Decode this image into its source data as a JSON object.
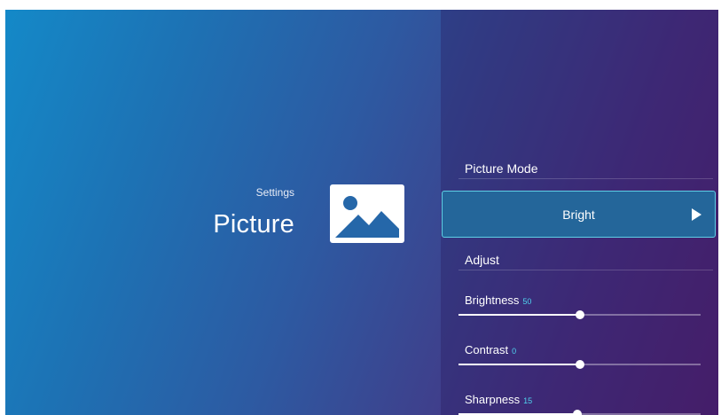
{
  "header": {
    "breadcrumb": "Settings",
    "title": "Picture",
    "icon": "picture-icon"
  },
  "menu": {
    "picture_mode": {
      "label": "Picture Mode",
      "value": "Bright",
      "arrow_icon": "play-right-icon"
    },
    "adjust": {
      "label": "Adjust"
    },
    "sliders": [
      {
        "label": "Brightness",
        "value": "50",
        "fraction": 0.5
      },
      {
        "label": "Contrast",
        "value": "0",
        "fraction": 0.5
      },
      {
        "label": "Sharpness",
        "value": "15",
        "fraction": 0.49
      }
    ]
  },
  "colors": {
    "accent": "#4fd3ee",
    "selector_fill": "#24669a",
    "selector_border": "#5fd0e6",
    "gradient_start": "#1489c8",
    "gradient_end": "#55206f"
  }
}
